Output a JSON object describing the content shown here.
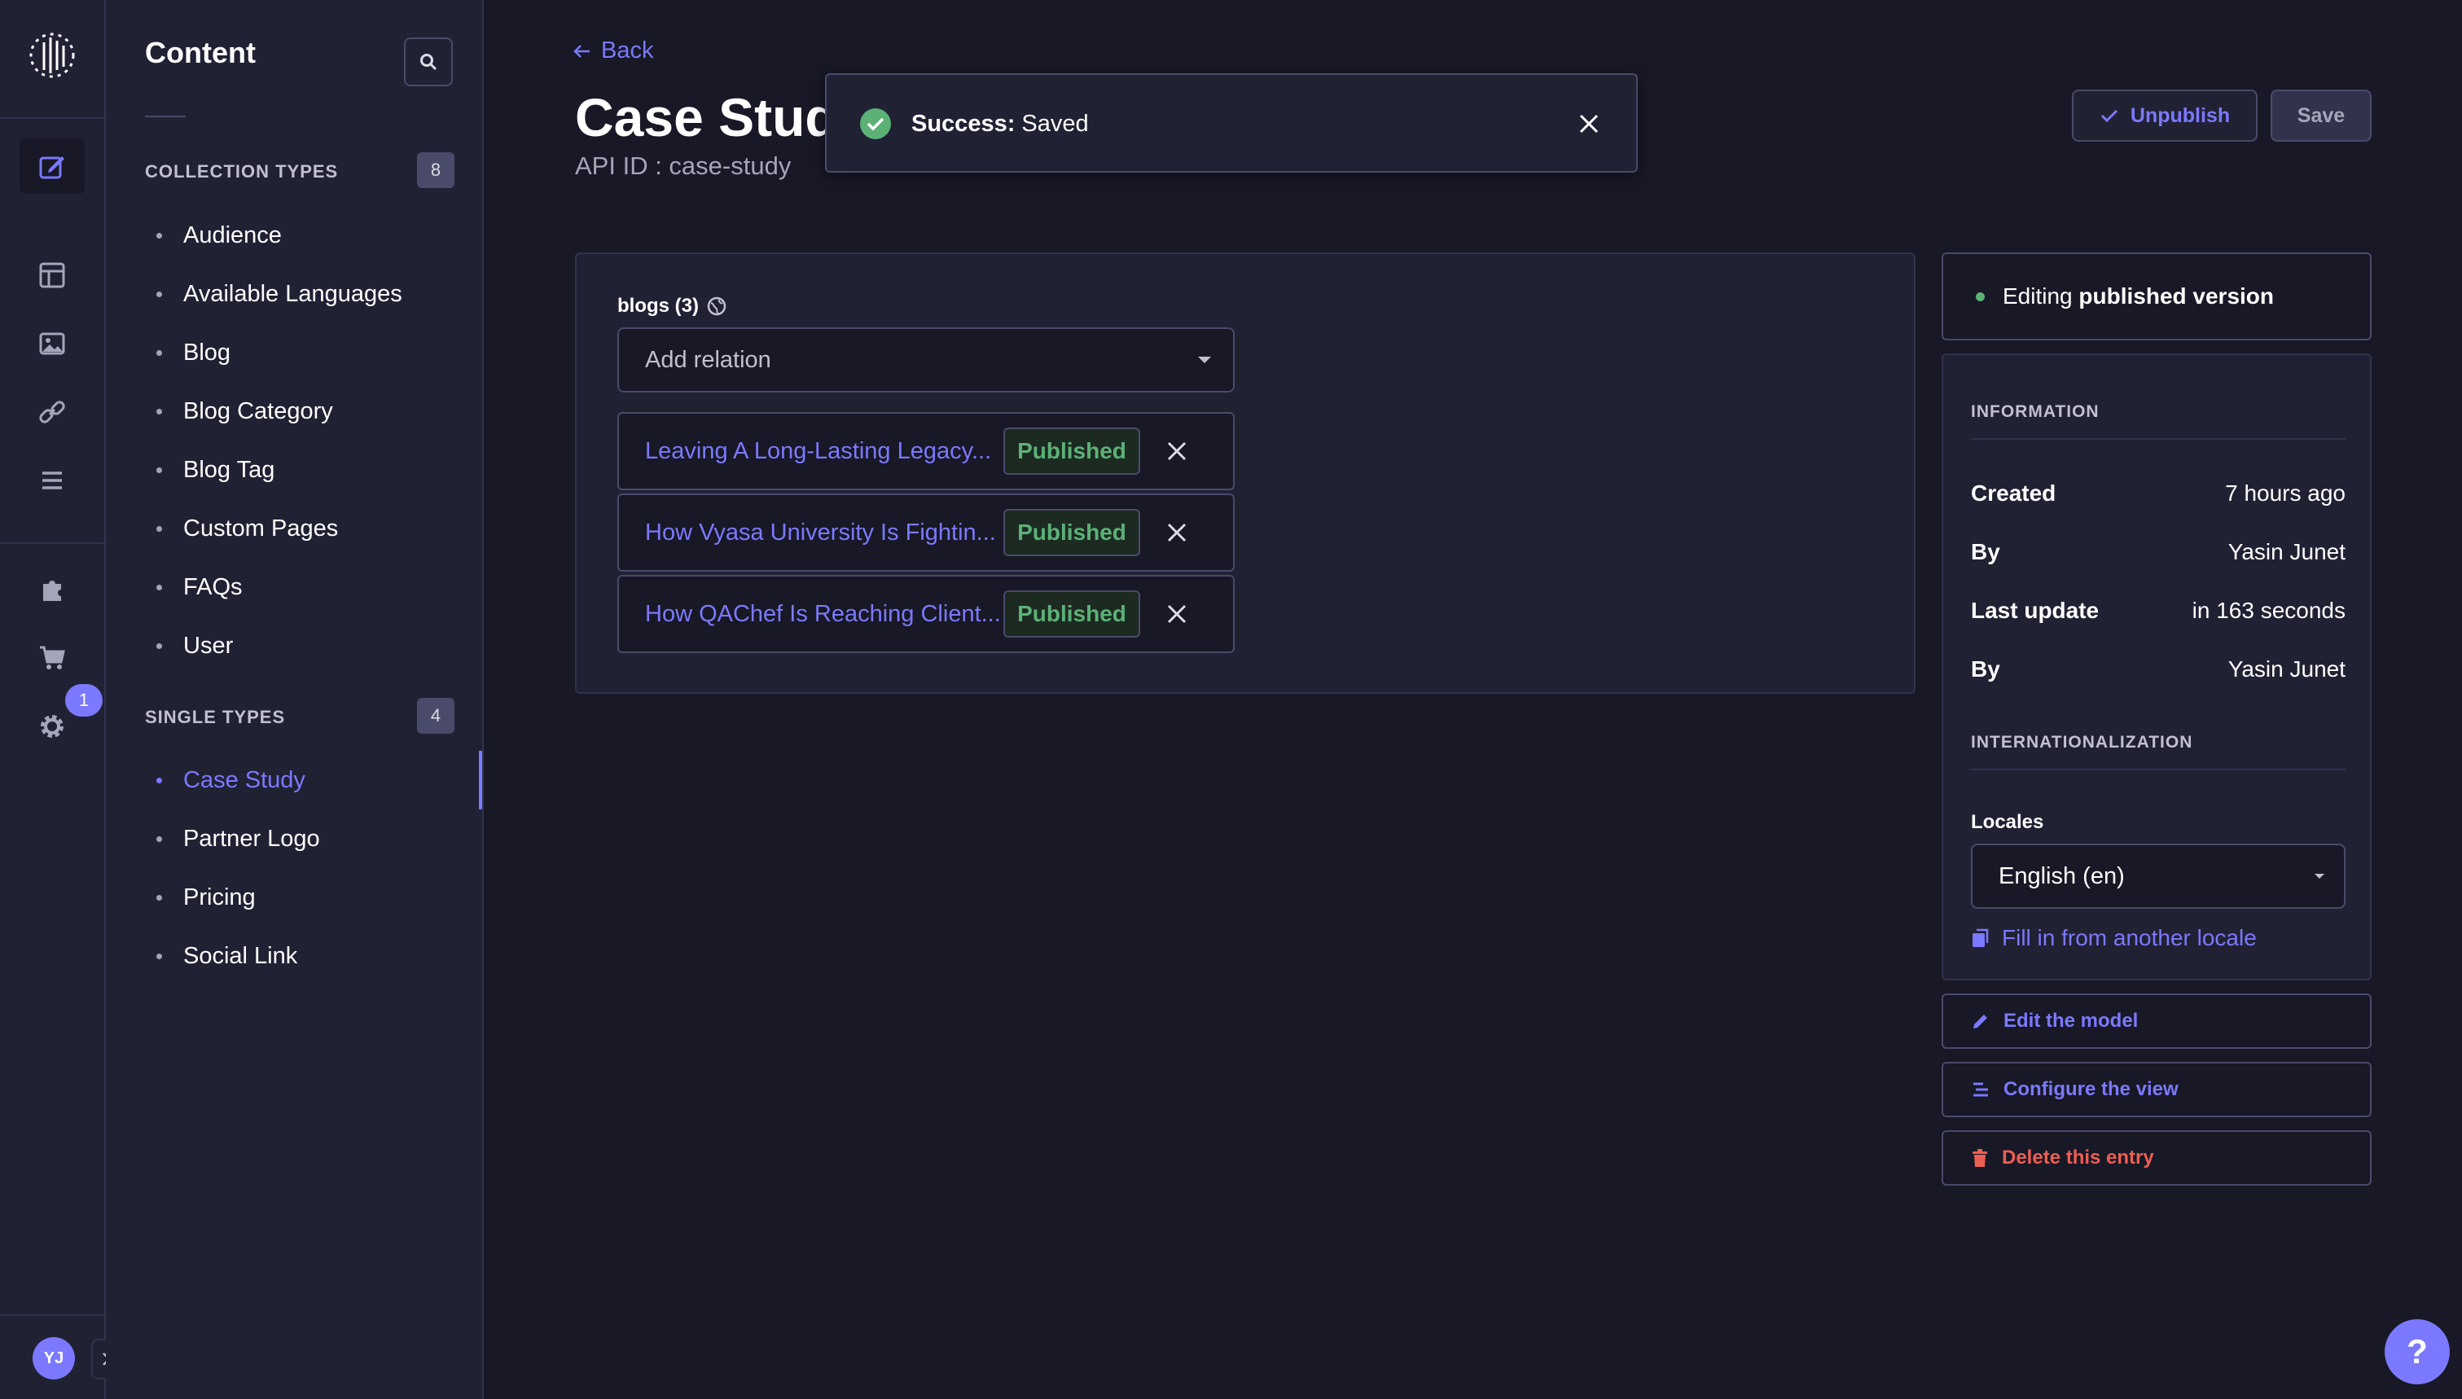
{
  "nav": {
    "items": [
      {
        "name": "content-manager-icon",
        "active": true
      },
      {
        "name": "content-type-builder-icon"
      },
      {
        "name": "media-library-icon"
      },
      {
        "name": "link-icon"
      },
      {
        "name": "list-icon"
      },
      {
        "name": "plugins-icon"
      },
      {
        "name": "marketplace-icon"
      },
      {
        "name": "settings-icon"
      }
    ],
    "settings_badge": "1",
    "avatar_initials": "YJ"
  },
  "subnav": {
    "title": "Content",
    "collection_types": {
      "heading": "COLLECTION TYPES",
      "count": "8",
      "items": [
        "Audience",
        "Available Languages",
        "Blog",
        "Blog Category",
        "Blog Tag",
        "Custom Pages",
        "FAQs",
        "User"
      ]
    },
    "single_types": {
      "heading": "SINGLE TYPES",
      "count": "4",
      "items": [
        "Case Study",
        "Partner Logo",
        "Pricing",
        "Social Link"
      ],
      "active": "Case Study"
    }
  },
  "header": {
    "back_label": "Back",
    "title": "Case Study",
    "api_id": "API ID : case-study",
    "unpublish_label": "Unpublish",
    "save_label": "Save"
  },
  "toast": {
    "title": "Success:",
    "message": "Saved"
  },
  "relation_field": {
    "label": "blogs (3)",
    "placeholder": "Add relation",
    "items": [
      {
        "title": "Leaving A Long-Lasting Legacy...",
        "status": "Published"
      },
      {
        "title": "How Vyasa University Is Fightin...",
        "status": "Published"
      },
      {
        "title": "How QAChef Is Reaching Client...",
        "status": "Published"
      }
    ]
  },
  "status": {
    "prefix": "Editing",
    "value": "published version"
  },
  "information": {
    "heading": "INFORMATION",
    "created_label": "Created",
    "created_value": "7 hours ago",
    "created_by_label": "By",
    "created_by_value": "Yasin Junet",
    "updated_label": "Last update",
    "updated_value": "in 163 seconds",
    "updated_by_label": "By",
    "updated_by_value": "Yasin Junet"
  },
  "i18n": {
    "heading": "INTERNATIONALIZATION",
    "locales_label": "Locales",
    "locale_value": "English (en)",
    "fill_link": "Fill in from another locale"
  },
  "actions": {
    "edit_model": "Edit the model",
    "configure_view": "Configure the view",
    "delete_entry": "Delete this entry"
  },
  "colors": {
    "primary": "#7b79ff",
    "success": "#5cb176",
    "danger": "#ee5e52",
    "background": "#181826",
    "panel": "#212134"
  }
}
